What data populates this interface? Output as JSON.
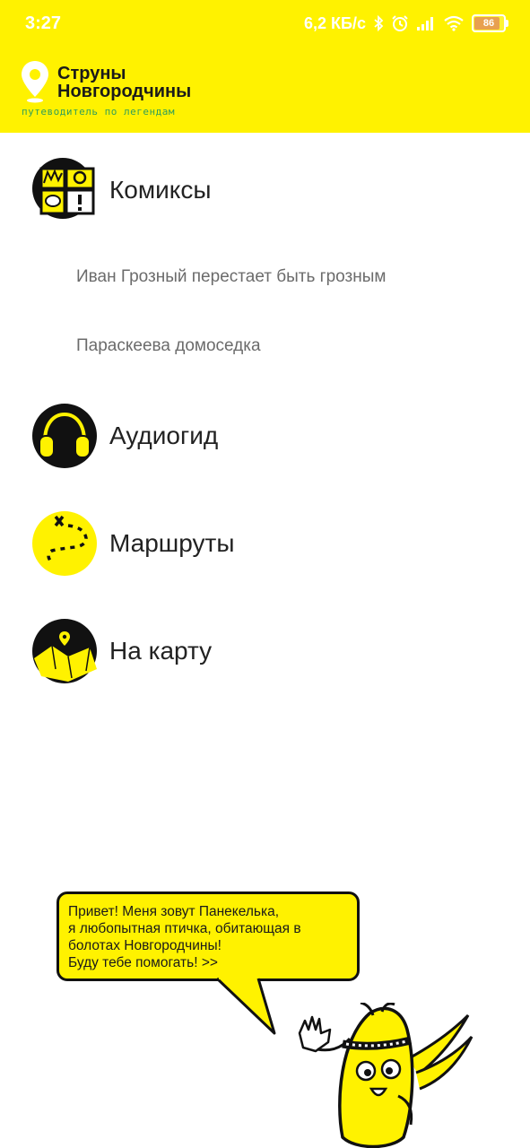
{
  "status_bar": {
    "time": "3:27",
    "network_speed": "6,2 КБ/с",
    "battery_level": "86",
    "icons": [
      "bluetooth-icon",
      "alarm-icon",
      "signal-icon",
      "wifi-icon",
      "battery-icon"
    ]
  },
  "header": {
    "title_line1": "Струны",
    "title_line2": "Новгородчины",
    "tagline": "путеводитель по легендам",
    "background_color": "#fff200"
  },
  "menu": {
    "comics": {
      "label": "Комиксы",
      "icon": "comics-icon"
    },
    "comics_items": [
      {
        "label": "Иван Грозный перестает быть грозным"
      },
      {
        "label": "Параскеева домоседка"
      }
    ],
    "audio": {
      "label": "Аудиогид",
      "icon": "headphones-icon"
    },
    "routes": {
      "label": "Маршруты",
      "icon": "route-map-icon"
    },
    "map": {
      "label": "На карту",
      "icon": "map-pin-icon"
    }
  },
  "mascot": {
    "speech_lines": [
      "Привет! Меня зовут Панекелька,",
      "я любопытная птичка, обитающая в",
      "болотах Новгородчины!",
      "Буду тебе помогать! >>"
    ]
  }
}
